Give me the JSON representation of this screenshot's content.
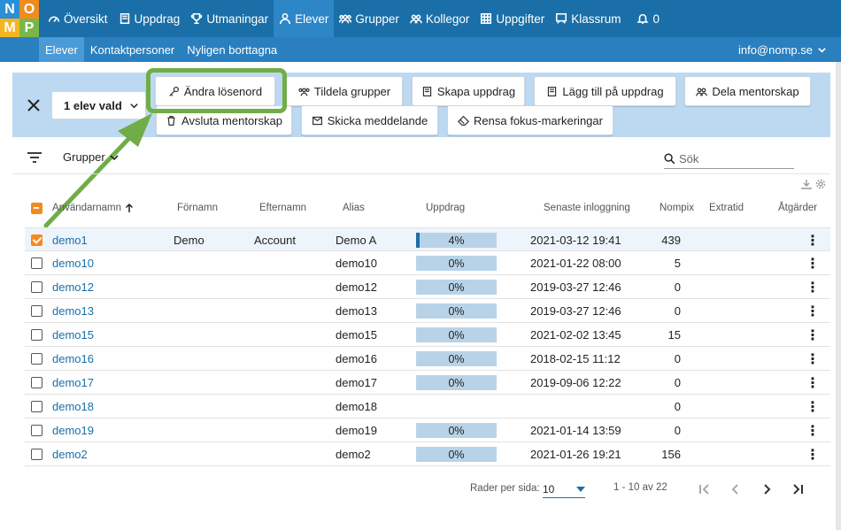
{
  "logo": {
    "letters": [
      "N",
      "O",
      "M",
      "P"
    ]
  },
  "nav": {
    "items": [
      {
        "label": "Översikt",
        "icon": "dashboard-icon"
      },
      {
        "label": "Uppdrag",
        "icon": "book-icon"
      },
      {
        "label": "Utmaningar",
        "icon": "trophy-icon"
      },
      {
        "label": "Elever",
        "icon": "user-icon",
        "active": true
      },
      {
        "label": "Grupper",
        "icon": "group-icon"
      },
      {
        "label": "Kollegor",
        "icon": "colleagues-icon"
      },
      {
        "label": "Uppgifter",
        "icon": "grid-icon"
      },
      {
        "label": "Klassrum",
        "icon": "classroom-icon"
      },
      {
        "label": "0",
        "icon": "bell-icon"
      }
    ]
  },
  "subnav": {
    "items": [
      "Elever",
      "Kontaktpersoner",
      "Nyligen borttagna"
    ],
    "user_email": "info@nomp.se"
  },
  "actionbar": {
    "selection_label": "1 elev vald",
    "buttons": [
      "Ändra lösenord",
      "Tildela grupper",
      "Skapa uppdrag",
      "Lägg till på uppdrag",
      "Dela mentorskap",
      "Avsluta mentorskap",
      "Skicka meddelande",
      "Rensa fokus-markeringar"
    ]
  },
  "filter": {
    "group_label": "Grupper",
    "search_placeholder": "Sök"
  },
  "table": {
    "headers": [
      "Användarnamn",
      "Förnamn",
      "Efternamn",
      "Alias",
      "Uppdrag",
      "Senaste inloggning",
      "Nompix",
      "Extratid",
      "Åtgärder"
    ],
    "rows": [
      {
        "username": "demo1",
        "first": "Demo",
        "last": "Account",
        "alias": "Demo A",
        "progress": "4%",
        "progress_value": 4,
        "login": "2021-03-12 19:41",
        "nompix": "439",
        "selected": true
      },
      {
        "username": "demo10",
        "first": "",
        "last": "",
        "alias": "demo10",
        "progress": "0%",
        "progress_value": 0,
        "login": "2021-01-22 08:00",
        "nompix": "5",
        "selected": false
      },
      {
        "username": "demo12",
        "first": "",
        "last": "",
        "alias": "demo12",
        "progress": "0%",
        "progress_value": 0,
        "login": "2019-03-27 12:46",
        "nompix": "0",
        "selected": false
      },
      {
        "username": "demo13",
        "first": "",
        "last": "",
        "alias": "demo13",
        "progress": "0%",
        "progress_value": 0,
        "login": "2019-03-27 12:46",
        "nompix": "0",
        "selected": false
      },
      {
        "username": "demo15",
        "first": "",
        "last": "",
        "alias": "demo15",
        "progress": "0%",
        "progress_value": 0,
        "login": "2021-02-02 13:45",
        "nompix": "15",
        "selected": false
      },
      {
        "username": "demo16",
        "first": "",
        "last": "",
        "alias": "demo16",
        "progress": "0%",
        "progress_value": 0,
        "login": "2018-02-15 11:12",
        "nompix": "0",
        "selected": false
      },
      {
        "username": "demo17",
        "first": "",
        "last": "",
        "alias": "demo17",
        "progress": "0%",
        "progress_value": 0,
        "login": "2019-09-06 12:22",
        "nompix": "0",
        "selected": false
      },
      {
        "username": "demo18",
        "first": "",
        "last": "",
        "alias": "demo18",
        "progress": "",
        "progress_value": null,
        "login": "",
        "nompix": "0",
        "selected": false
      },
      {
        "username": "demo19",
        "first": "",
        "last": "",
        "alias": "demo19",
        "progress": "0%",
        "progress_value": 0,
        "login": "2021-01-14 13:59",
        "nompix": "0",
        "selected": false
      },
      {
        "username": "demo2",
        "first": "",
        "last": "",
        "alias": "demo2",
        "progress": "0%",
        "progress_value": 0,
        "login": "2021-01-26 19:21",
        "nompix": "156",
        "selected": false
      }
    ]
  },
  "pagination": {
    "rows_per_page_label": "Rader per sida:",
    "rows_per_page": "10",
    "range": "1 - 10 av 22"
  },
  "colors": {
    "topbar": "#1a6fa8",
    "actionbar": "#bdd9f1",
    "highlight": "#70ad47",
    "checkbox": "#f5891f"
  }
}
